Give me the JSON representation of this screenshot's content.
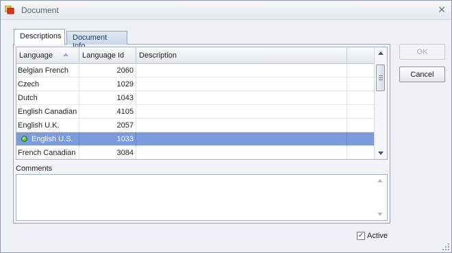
{
  "window": {
    "title": "Document",
    "close_glyph": "✕"
  },
  "tabs": [
    {
      "label": "Descriptions",
      "active": true
    },
    {
      "label": "Document Info",
      "active": false
    }
  ],
  "grid": {
    "columns": [
      "Language",
      "Language Id",
      "Description",
      ""
    ],
    "sorted_column": "Language",
    "rows": [
      {
        "language": "Belgian French",
        "id": "2060",
        "description": ""
      },
      {
        "language": "Czech",
        "id": "1029",
        "description": ""
      },
      {
        "language": "Dutch",
        "id": "1043",
        "description": ""
      },
      {
        "language": "English Canadian",
        "id": "4105",
        "description": ""
      },
      {
        "language": "English U.K.",
        "id": "2057",
        "description": ""
      },
      {
        "language": "English U.S.",
        "id": "1033",
        "description": "",
        "selected": true,
        "indicator": "green-dot-icon"
      },
      {
        "language": "French Canadian",
        "id": "3084",
        "description": ""
      }
    ]
  },
  "comments": {
    "label": "Comments",
    "value": ""
  },
  "buttons": {
    "ok": "OK",
    "cancel": "Cancel"
  },
  "active": {
    "label": "Active",
    "checked": true,
    "check_glyph": "✓"
  },
  "colors": {
    "selection": "#7b9bdc",
    "tab_inactive_text": "#1f3d6e"
  }
}
